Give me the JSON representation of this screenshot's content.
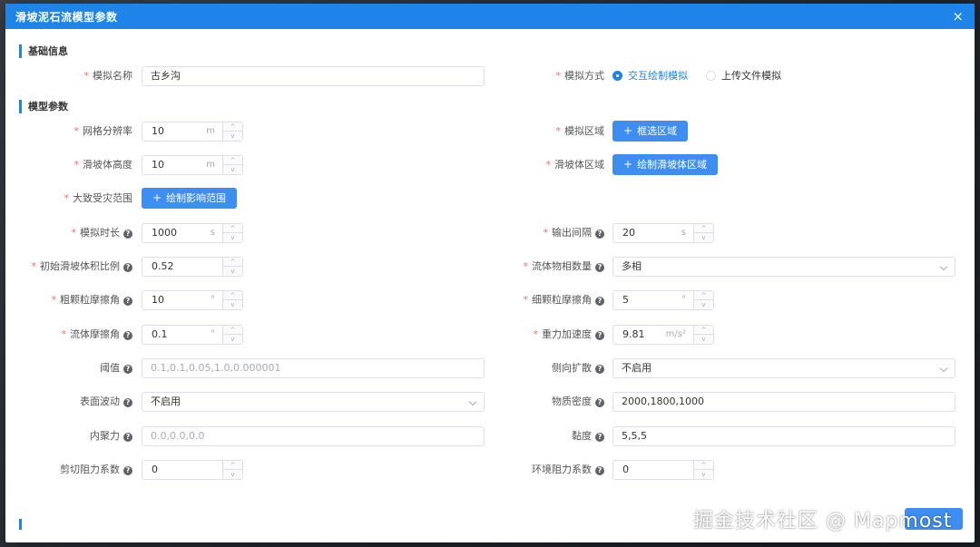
{
  "dialog": {
    "title": "滑坡泥石流模型参数"
  },
  "sections": {
    "basic": "基础信息",
    "model": "模型参数"
  },
  "fields": {
    "sim_name": {
      "label": "模拟名称",
      "value": "古乡沟"
    },
    "sim_mode": {
      "label": "模拟方式",
      "options": [
        "交互绘制模拟",
        "上传文件模拟"
      ],
      "selected": "交互绘制模拟"
    },
    "grid_res": {
      "label": "网格分辨率",
      "value": "10",
      "unit": "m"
    },
    "sim_area": {
      "label": "模拟区域",
      "button": "框选区域"
    },
    "slide_height": {
      "label": "滑坡体高度",
      "value": "10",
      "unit": "m"
    },
    "slide_area": {
      "label": "滑坡体区域",
      "button": "绘制滑坡体区域"
    },
    "impact_range": {
      "label": "大致受灾范围",
      "button": "绘制影响范围"
    },
    "sim_duration": {
      "label": "模拟时长",
      "value": "1000",
      "unit": "s"
    },
    "output_interval": {
      "label": "输出间隔",
      "value": "20",
      "unit": "s"
    },
    "init_ratio": {
      "label": "初始滑坡体积比例",
      "value": "0.52"
    },
    "phase_count": {
      "label": "流体物相数量",
      "value": "多相"
    },
    "coarse_friction": {
      "label": "粗颗粒摩擦角",
      "value": "10",
      "unit": "°"
    },
    "fine_friction": {
      "label": "细颗粒摩擦角",
      "value": "5",
      "unit": "°"
    },
    "fluid_friction": {
      "label": "流体摩擦角",
      "value": "0.1",
      "unit": "°"
    },
    "gravity": {
      "label": "重力加速度",
      "value": "9.81",
      "unit": "m/s²"
    },
    "threshold": {
      "label": "阈值",
      "placeholder": "0.1,0.1,0.05,1.0,0.000001"
    },
    "lateral_spread": {
      "label": "侧向扩散",
      "value": "不启用"
    },
    "surface_wave": {
      "label": "表面波动",
      "value": "不启用"
    },
    "density": {
      "label": "物质密度",
      "value": "2000,1800,1000"
    },
    "cohesion": {
      "label": "内聚力",
      "placeholder": "0.0,0.0,0.0"
    },
    "viscosity": {
      "label": "黏度",
      "value": "5,5,5"
    },
    "shear_coef": {
      "label": "剪切阻力系数",
      "value": "0"
    },
    "env_coef": {
      "label": "环境阻力系数",
      "value": "0"
    }
  },
  "icons": {
    "close": "×",
    "help": "?",
    "plus": "+",
    "step_up": "^",
    "step_down": "v"
  },
  "watermark": "掘金技术社区 @ Mapmost",
  "colors": {
    "primary": "#1e84e8",
    "required": "#f56c6c"
  }
}
